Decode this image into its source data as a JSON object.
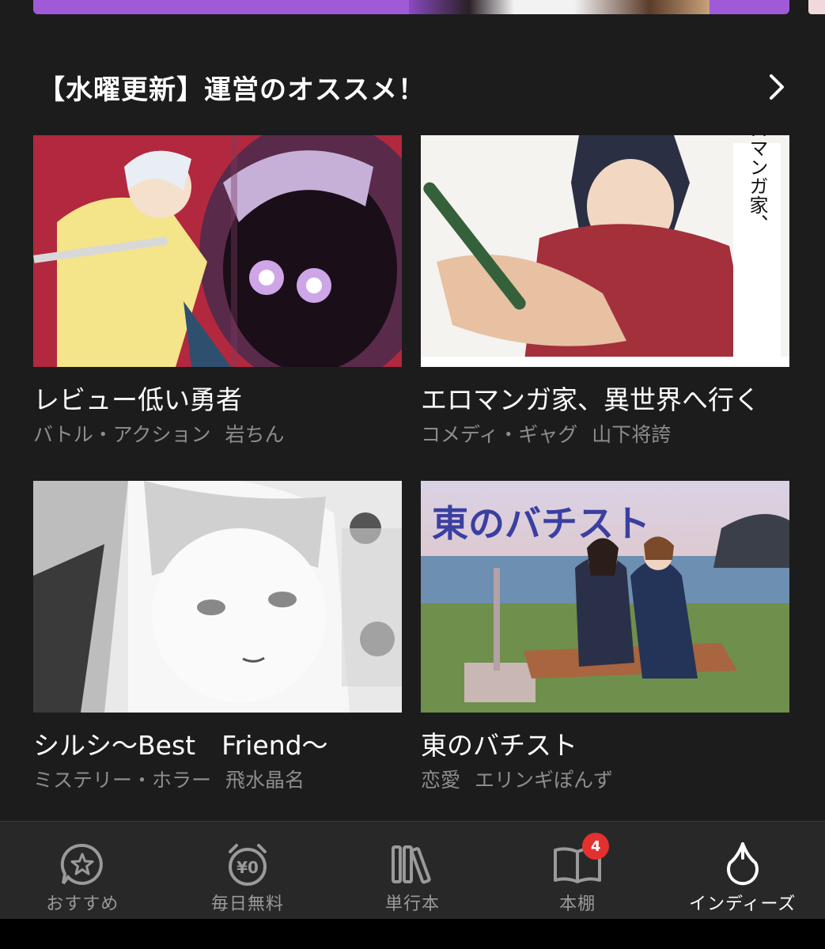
{
  "section": {
    "title": "【水曜更新】運営のオススメ！"
  },
  "cards": [
    {
      "title": "レビュー低い勇者",
      "genre": "バトル・アクション",
      "author": "岩ちん"
    },
    {
      "title": "エロマンガ家、異世界へ行く",
      "genre": "コメディ・ギャグ",
      "author": "山下将誇",
      "cover_text": "エロマンガ家、異世界へ行く"
    },
    {
      "title": "シルシ〜Best　Friend〜",
      "genre": "ミステリー・ホラー",
      "author": "飛水晶名"
    },
    {
      "title": "東のバチスト",
      "genre": "恋愛",
      "author": "エリンギぽんず",
      "cover_text": "東のバチスト"
    }
  ],
  "nav": {
    "items": [
      {
        "label": "おすすめ",
        "icon": "star-bubble-icon"
      },
      {
        "label": "毎日無料",
        "icon": "alarm-yen-icon",
        "icon_text": "¥0"
      },
      {
        "label": "単行本",
        "icon": "books-icon"
      },
      {
        "label": "本棚",
        "icon": "open-book-icon",
        "badge": "4"
      },
      {
        "label": "インディーズ",
        "icon": "drop-icon",
        "active": true
      }
    ]
  },
  "colors": {
    "background": "#1c1c1c",
    "nav_background": "#282828",
    "badge": "#e53030",
    "muted_text": "#8d8d8d"
  }
}
